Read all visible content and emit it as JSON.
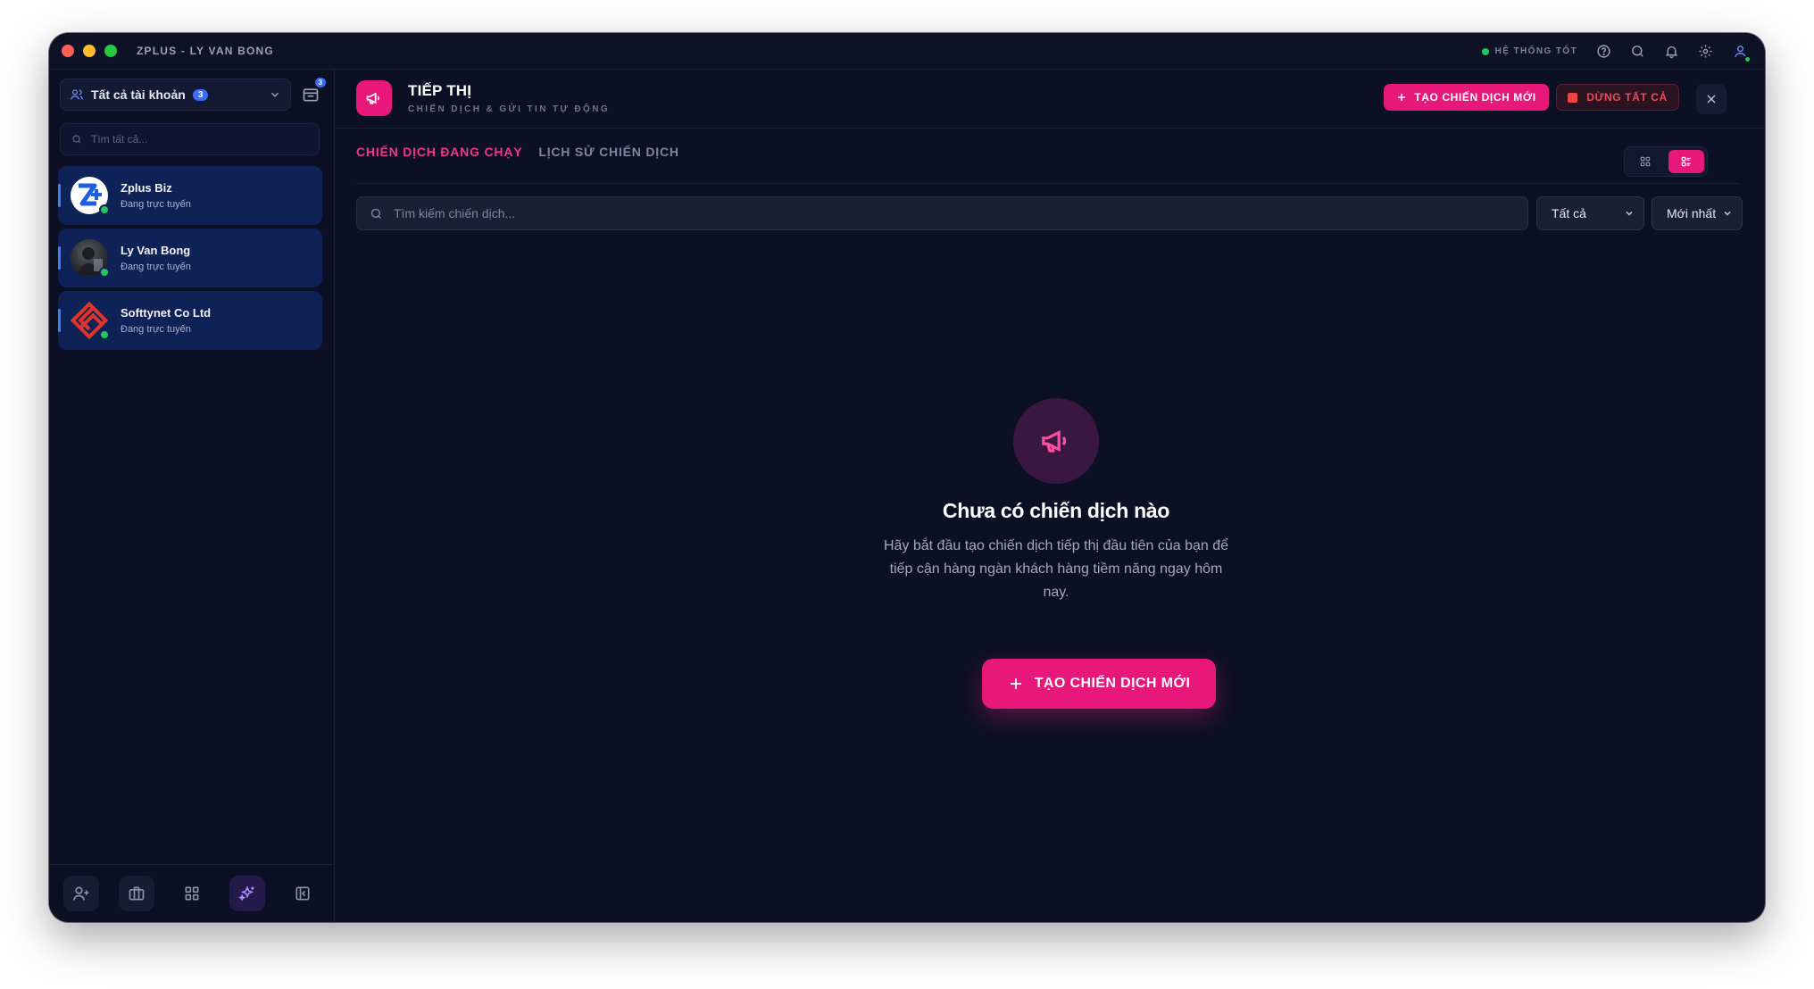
{
  "window": {
    "title": "ZPLUS - LY VAN BONG",
    "system_status": "HỆ THỐNG TỐT"
  },
  "sidebar": {
    "account_selector_label": "Tất cả tài khoản",
    "account_count": "3",
    "inbox_count": "3",
    "search_placeholder": "Tìm tất cả...",
    "accounts": [
      {
        "name": "Zplus Biz",
        "status": "Đang trực tuyến"
      },
      {
        "name": "Ly Van Bong",
        "status": "Đang trực tuyến"
      },
      {
        "name": "Softtynet Co Ltd",
        "status": "Đang trực tuyến"
      }
    ]
  },
  "header": {
    "title": "TIẾP THỊ",
    "subtitle": "CHIẾN DỊCH & GỬI TIN TỰ ĐỘNG",
    "create_label": "TẠO CHIẾN DỊCH MỚI",
    "stop_label": "DỪNG TẤT CẢ"
  },
  "tabs": [
    {
      "label": "CHIẾN DỊCH ĐANG CHẠY",
      "active": true
    },
    {
      "label": "LỊCH SỬ CHIẾN DỊCH",
      "active": false
    }
  ],
  "filters": {
    "search_placeholder": "Tìm kiếm chiến dịch...",
    "status_value": "Tất cả",
    "sort_value": "Mới nhất"
  },
  "empty_state": {
    "title": "Chưa có chiến dịch nào",
    "description": "Hãy bắt đầu tạo chiến dịch tiếp thị đầu tiên của bạn để tiếp cận hàng ngàn khách hàng tiềm năng ngay hôm nay.",
    "button_label": "TẠO CHIẾN DỊCH MỚI"
  },
  "colors": {
    "accent": "#e8177a",
    "background": "#0b1024",
    "account_card": "#0f2257",
    "online": "#22c55e"
  }
}
